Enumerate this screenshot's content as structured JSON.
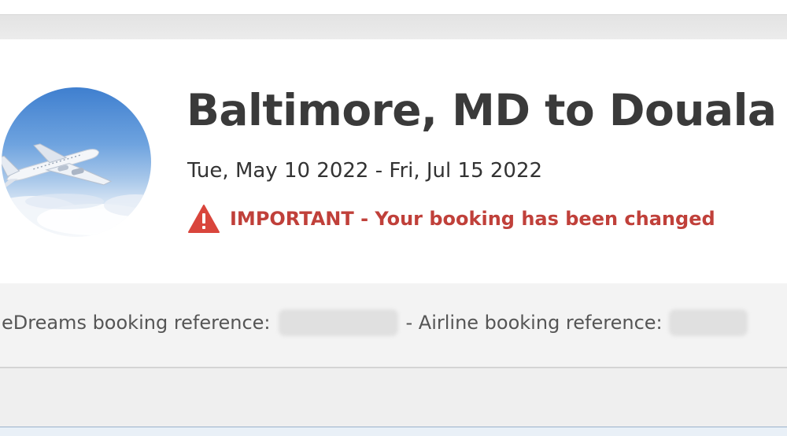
{
  "trip": {
    "title": "Baltimore, MD to Douala",
    "dates": "Tue, May 10 2022 - Fri, Jul 15 2022",
    "image_icon": "airplane-photo-icon"
  },
  "alert": {
    "icon": "warning-triangle-icon",
    "text": "IMPORTANT - Your booking has been changed",
    "color": "#c0403a"
  },
  "references": {
    "edreams_label": "eDreams booking reference:",
    "airline_label": "- Airline booking reference:"
  }
}
